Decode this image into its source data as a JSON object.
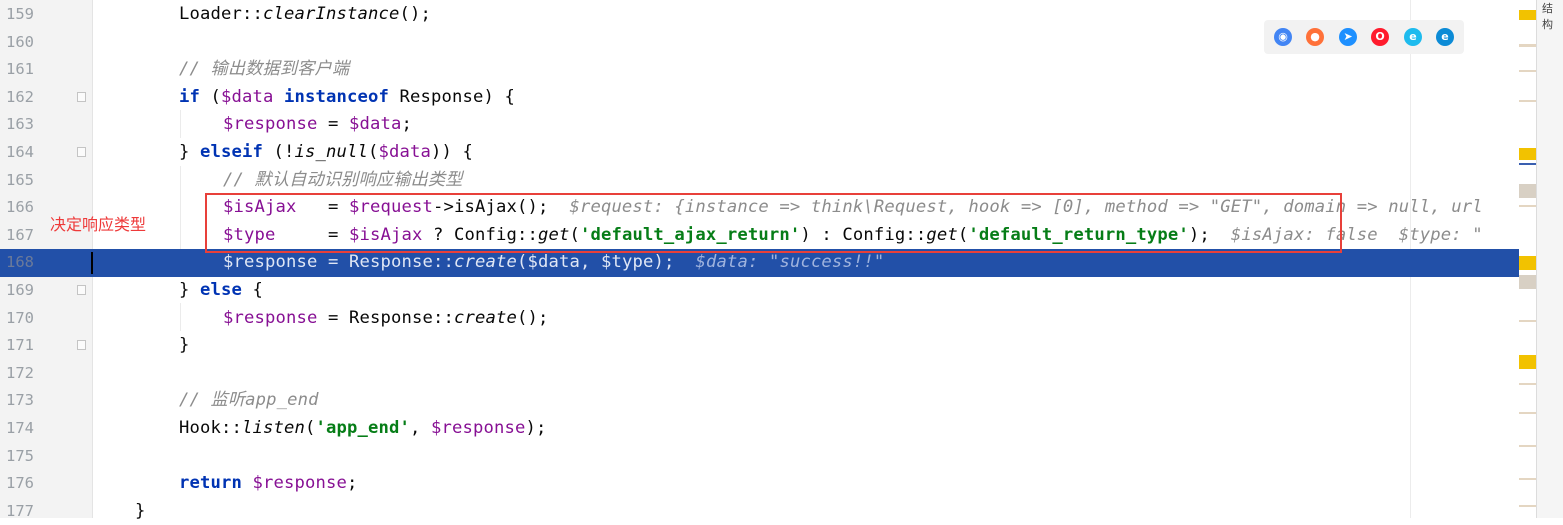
{
  "editor": {
    "lines": [
      {
        "n": "159"
      },
      {
        "n": "160"
      },
      {
        "n": "161"
      },
      {
        "n": "162"
      },
      {
        "n": "163"
      },
      {
        "n": "164"
      },
      {
        "n": "165"
      },
      {
        "n": "166"
      },
      {
        "n": "167"
      },
      {
        "n": "168"
      },
      {
        "n": "169"
      },
      {
        "n": "170"
      },
      {
        "n": "171"
      },
      {
        "n": "172"
      },
      {
        "n": "173"
      },
      {
        "n": "174"
      },
      {
        "n": "175"
      },
      {
        "n": "176"
      },
      {
        "n": "177"
      }
    ]
  },
  "tokens": {
    "l159": [
      "Loader::",
      "clearInstance",
      "();"
    ],
    "l161": "// 输出数据到客户端",
    "l162": [
      "if",
      " (",
      "$data",
      " ",
      "instanceof",
      " Response) {"
    ],
    "l163": [
      "$response",
      " = ",
      "$data",
      ";"
    ],
    "l164": [
      "} ",
      "elseif",
      " (!",
      "is_null",
      "(",
      "$data",
      ")) {"
    ],
    "l165": "// 默认自动识别响应输出类型",
    "l166": [
      "$isAjax",
      "   = ",
      "$request",
      "->isAjax();",
      "  $request: {instance => think\\Request, hook => [0], method => \"GET\", domain => null, url"
    ],
    "l167": [
      "$type",
      "     = ",
      "$isAjax",
      " ? Config::",
      "get",
      "(",
      "'default_ajax_return'",
      ") : Config::",
      "get",
      "(",
      "'default_return_type'",
      ");",
      "  $isAjax: false  $type: \""
    ],
    "l168": [
      "$response",
      " = Response::",
      "create",
      "(",
      "$data",
      ", ",
      "$type",
      ");",
      "  $data: \"success!!\""
    ],
    "l169": [
      "} ",
      "else",
      " {"
    ],
    "l170": [
      "$response",
      " = Response::",
      "create",
      "();"
    ],
    "l171": "}",
    "l173": "// 监听app_end",
    "l174": [
      "Hook::",
      "listen",
      "(",
      "'app_end'",
      ", ",
      "$response",
      ");"
    ],
    "l176": [
      "return",
      " ",
      "$response",
      ";"
    ],
    "l177": "}"
  },
  "annotation": {
    "label": "决定响应类型",
    "color": "#e8403a"
  },
  "browser_icons": [
    {
      "name": "chrome-icon",
      "color": "#4285f4",
      "glyph": "◉"
    },
    {
      "name": "firefox-icon",
      "color": "#ff7139",
      "glyph": "●"
    },
    {
      "name": "safari-icon",
      "color": "#1e90ff",
      "glyph": "➤"
    },
    {
      "name": "opera-icon",
      "color": "#ff1b2d",
      "glyph": "O"
    },
    {
      "name": "ie-icon",
      "color": "#1ebbee",
      "glyph": "e"
    },
    {
      "name": "edge-icon",
      "color": "#0c8bd6",
      "glyph": "e"
    }
  ],
  "right_panel": {
    "label": "结构"
  },
  "colors": {
    "current_line": "#2250a8",
    "keyword": "#0033b3",
    "variable": "#871094",
    "string": "#067d17",
    "comment": "#8c8c8c"
  }
}
